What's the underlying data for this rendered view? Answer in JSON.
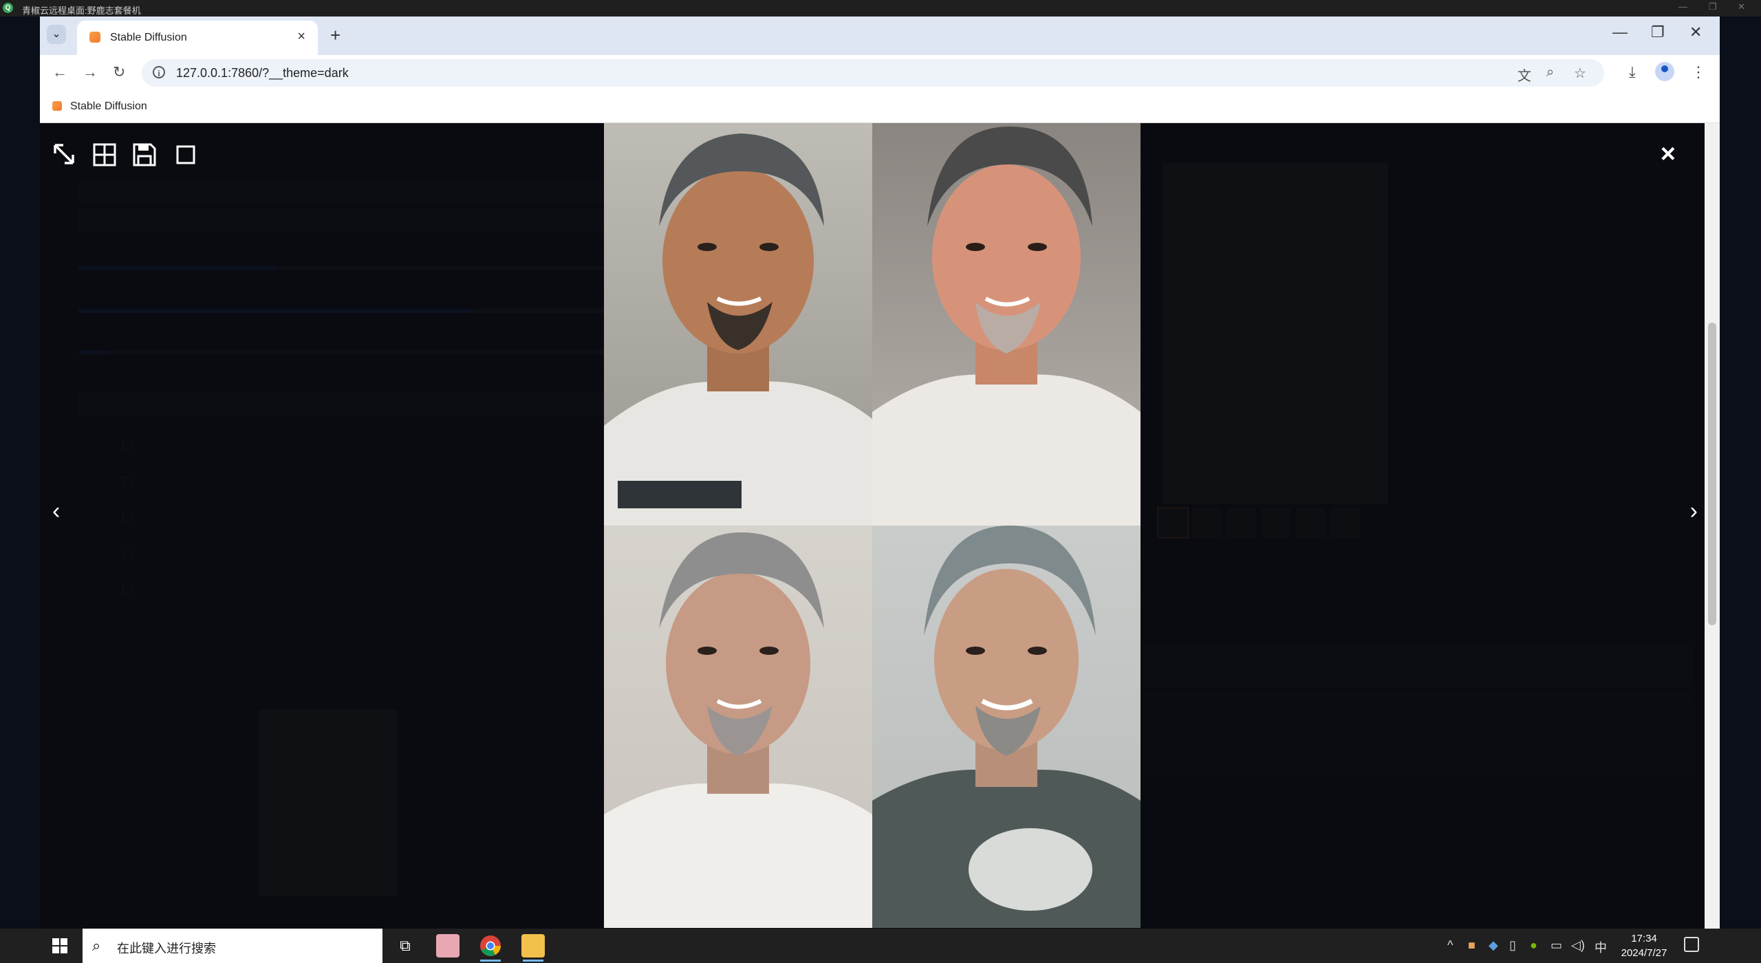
{
  "remote_desktop": {
    "title": "青椒云远程桌面:野鹿志套餐机",
    "logo_letter": "Q"
  },
  "browser": {
    "tab_title": "Stable Diffusion",
    "tab_close": "×",
    "new_tab": "+",
    "tab_dropdown": "⌄",
    "url": "127.0.0.1:7860/?__theme=dark",
    "bookmark": "Stable Diffusion",
    "minimize": "—",
    "restore": "❐",
    "close": "✕"
  },
  "lightbox": {
    "close_glyph": "×",
    "prev_glyph": "‹",
    "next_glyph": "›",
    "tools": [
      "zoom-toggle-icon",
      "grid-icon",
      "save-icon",
      "fullscreen-icon"
    ]
  },
  "taskbar": {
    "search_placeholder": "在此键入进行搜索",
    "ime": "中",
    "time": "17:34",
    "date": "2024/7/27"
  },
  "colors": {
    "page_bg": "#0b0f19",
    "tab_strip": "#dfe6f3",
    "accent": "#f47a2a",
    "taskbar": "#202020"
  }
}
